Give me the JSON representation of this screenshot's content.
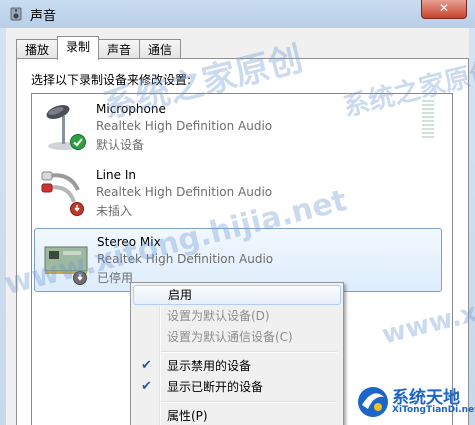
{
  "window": {
    "title": "声音",
    "close_label": "✕"
  },
  "tabs": [
    {
      "label": "播放"
    },
    {
      "label": "录制"
    },
    {
      "label": "声音"
    },
    {
      "label": "通信"
    }
  ],
  "instruction": "选择以下录制设备来修改设置:",
  "devices": [
    {
      "name": "Microphone",
      "driver": "Realtek High Definition Audio",
      "status": "默认设备"
    },
    {
      "name": "Line In",
      "driver": "Realtek High Definition Audio",
      "status": "未插入"
    },
    {
      "name": "Stereo Mix",
      "driver": "Realtek High Definition Audio",
      "status": "已停用"
    }
  ],
  "context_menu": {
    "items": [
      {
        "label": "启用"
      },
      {
        "label": "设置为默认设备(D)"
      },
      {
        "label": "设置为默认通信设备(C)"
      },
      {
        "label": "显示禁用的设备"
      },
      {
        "label": "显示已断开的设备"
      },
      {
        "label": "属性(P)"
      }
    ]
  },
  "watermarks": {
    "line1": "系统之家原创",
    "line2": "www.xitong.hijia.net",
    "line3": "系统之家原创www",
    "line4": "www.xitong",
    "line5": "家原创"
  },
  "logo": {
    "name": "系统天地",
    "domain": "XiTongTianDi.net"
  },
  "colors": {
    "selection": "#dcecfc",
    "menu_highlight": "#e8f0fb",
    "check": "#2a5aa6",
    "default_badge": "#2ea043",
    "unplugged_badge": "#c0392b"
  }
}
